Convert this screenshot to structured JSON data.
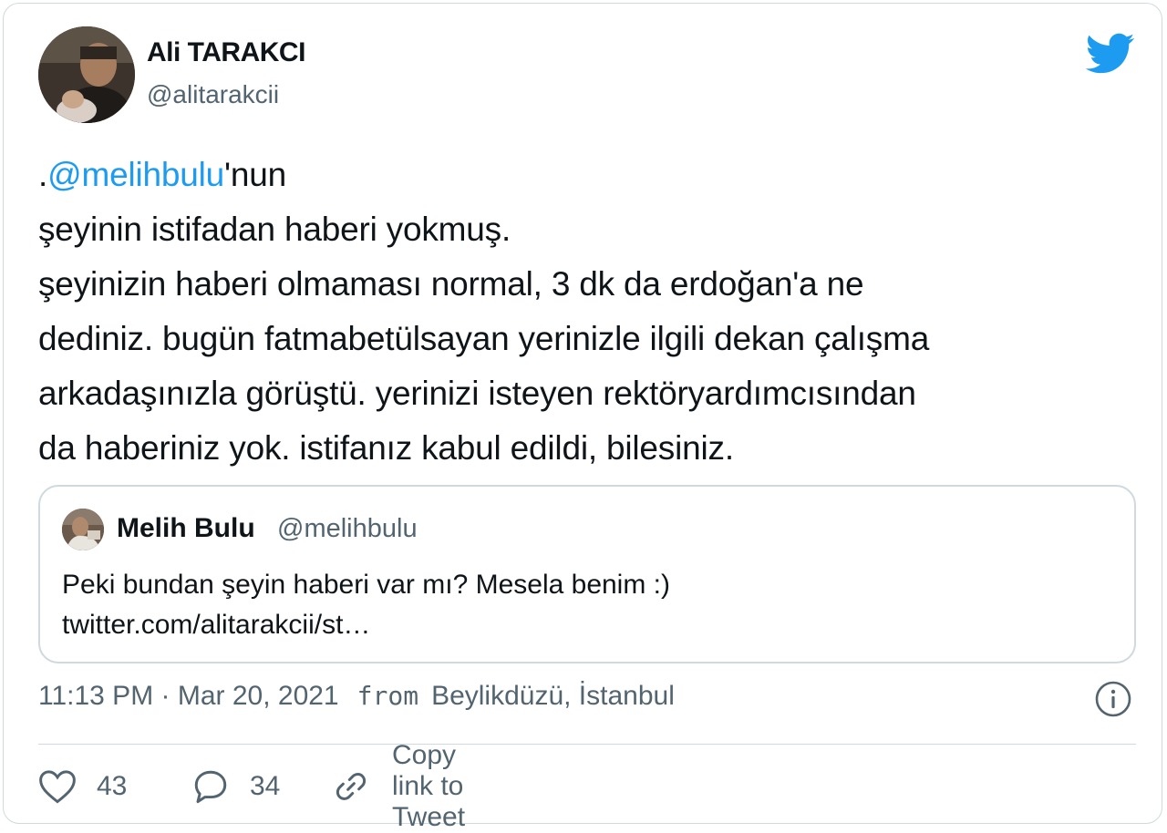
{
  "author": {
    "name": "Ali TARAKCI",
    "handle": "@alitarakcii"
  },
  "icons": {
    "logo": "twitter-bird-icon",
    "info": "info-icon",
    "like": "heart-icon",
    "reply": "reply-bubble-icon",
    "link": "link-icon"
  },
  "colors": {
    "accent": "#1d9bf0",
    "muted": "#536471",
    "border": "#cfd9de"
  },
  "tweet": {
    "line1_prefix": ".",
    "mention": "@melihbulu",
    "line1_suffix": "'nun",
    "line2": "şeyinin istifadan haberi yokmuş.",
    "line3": "şeyinizin haberi olmaması normal, 3 dk da erdoğan'a ne",
    "line4": "dediniz. bugün fatmabetülsayan yerinizle ilgili dekan çalışma",
    "line5": "arkadaşınızla görüştü. yerinizi isteyen rektöryardımcısından",
    "line6": "da haberiniz yok. istifanız kabul edildi, bilesiniz."
  },
  "quoted": {
    "name": "Melih Bulu",
    "handle": "@melihbulu",
    "text_line1": "Peki bundan şeyin haberi var mı? Mesela benim :)",
    "text_line2": "twitter.com/alitarakcii/st…"
  },
  "meta": {
    "time": "11:13 PM · Mar 20, 2021",
    "from_label": "from",
    "location": "Beylikdüzü, İstanbul"
  },
  "actions": {
    "likes": "43",
    "replies": "34",
    "copy_link": "Copy link to Tweet"
  }
}
